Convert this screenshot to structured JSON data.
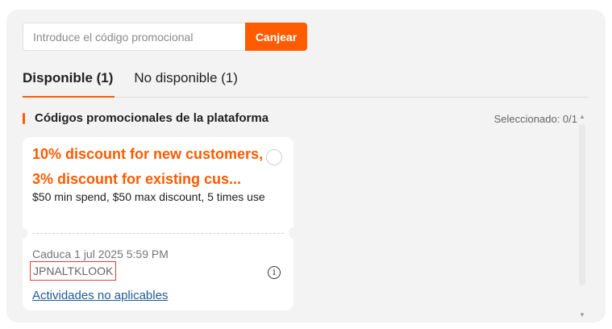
{
  "promo": {
    "placeholder": "Introduce el código promocional",
    "value": "",
    "redeem_label": "Canjear"
  },
  "tabs": [
    {
      "label": "Disponible (1)",
      "active": true
    },
    {
      "label": "No disponible (1)",
      "active": false
    }
  ],
  "section": {
    "title": "Códigos promocionales de la plataforma",
    "selected": "Seleccionado: 0/1"
  },
  "coupon": {
    "title": "10% discount for new customers, 3% discount for existing cus...",
    "description": "$50 min spend, $50 max discount, 5 times use",
    "expiry": "Caduca 1 jul 2025 5:59 PM",
    "code": "JPNALTKLOOK",
    "inapplicable_link": "Actividades no aplicables",
    "selected": false,
    "info_icon": "info-icon"
  },
  "colors": {
    "accent": "#ff5b00",
    "panel_bg": "#f3f3f3",
    "link": "#1f5a96",
    "highlight_border": "#e33a3a"
  }
}
